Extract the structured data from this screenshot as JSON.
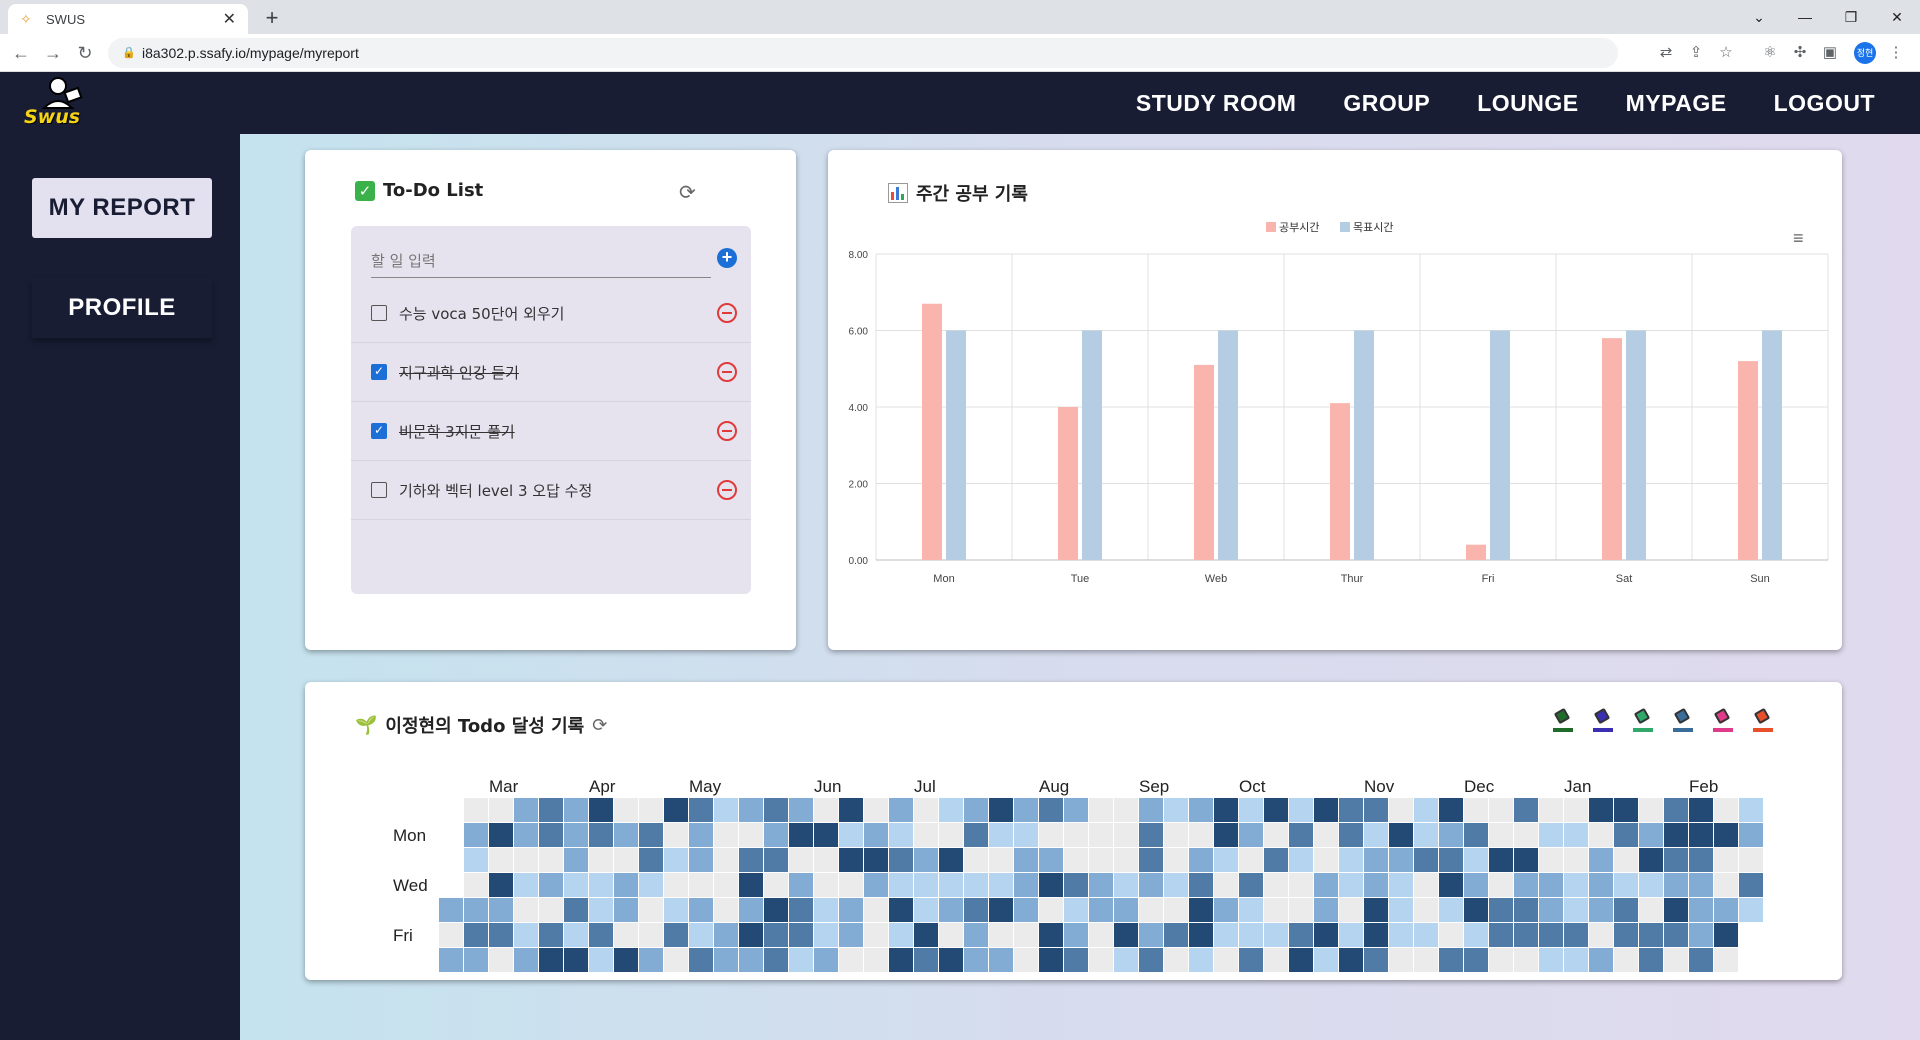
{
  "browser": {
    "tab_title": "SWUS",
    "url": "i8a302.p.ssafy.io/mypage/myreport",
    "profile_initials": "정현"
  },
  "header": {
    "logo_text": "Swus",
    "nav": [
      "STUDY ROOM",
      "GROUP",
      "LOUNGE",
      "MYPAGE",
      "LOGOUT"
    ]
  },
  "sidebar": {
    "items": [
      {
        "label": "MY REPORT",
        "active": true
      },
      {
        "label": "PROFILE",
        "active": false
      }
    ]
  },
  "todo": {
    "title": "To-Do List",
    "placeholder": "할 일 입력",
    "items": [
      {
        "text": "수능 voca 50단어 외우기",
        "done": false
      },
      {
        "text": "지구과학 인강 듣기",
        "done": true
      },
      {
        "text": "비문학 3지문 풀기",
        "done": true
      },
      {
        "text": "기하와 벡터 level 3 오답 수정",
        "done": false
      }
    ]
  },
  "weekly": {
    "title": "주간 공부 기록",
    "chart_data": {
      "type": "bar",
      "categories": [
        "Mon",
        "Tue",
        "Web",
        "Thur",
        "Fri",
        "Sat",
        "Sun"
      ],
      "series": [
        {
          "name": "공부시간",
          "color": "#f9b4ad",
          "values": [
            6.7,
            4.0,
            5.1,
            4.1,
            0.4,
            5.8,
            5.2
          ]
        },
        {
          "name": "목표시간",
          "color": "#b4cde3",
          "values": [
            6.0,
            6.0,
            6.0,
            6.0,
            6.0,
            6.0,
            6.0
          ]
        }
      ],
      "ylim": [
        0,
        8
      ],
      "yticks": [
        "0.00",
        "2.00",
        "4.00",
        "6.00",
        "8.00"
      ],
      "legend": "top-center",
      "grid": true
    }
  },
  "heatmap": {
    "title": "이정현의 Todo 달성 기록",
    "months": [
      "Mar",
      "Apr",
      "May",
      "Jun",
      "Jul",
      "Aug",
      "Sep",
      "Oct",
      "Nov",
      "Dec",
      "Jan",
      "Feb"
    ],
    "weekdays": [
      "Mon",
      "Wed",
      "Fri"
    ],
    "palette": [
      "#ebebeb",
      "#b4d4ef",
      "#83acd4",
      "#4f7ba6",
      "#234a74"
    ],
    "paint_colors": [
      "#1e6b2a",
      "#3a2fb0",
      "#2fa86a",
      "#3a6c9a",
      "#e03a8a",
      "#e8502a"
    ]
  }
}
